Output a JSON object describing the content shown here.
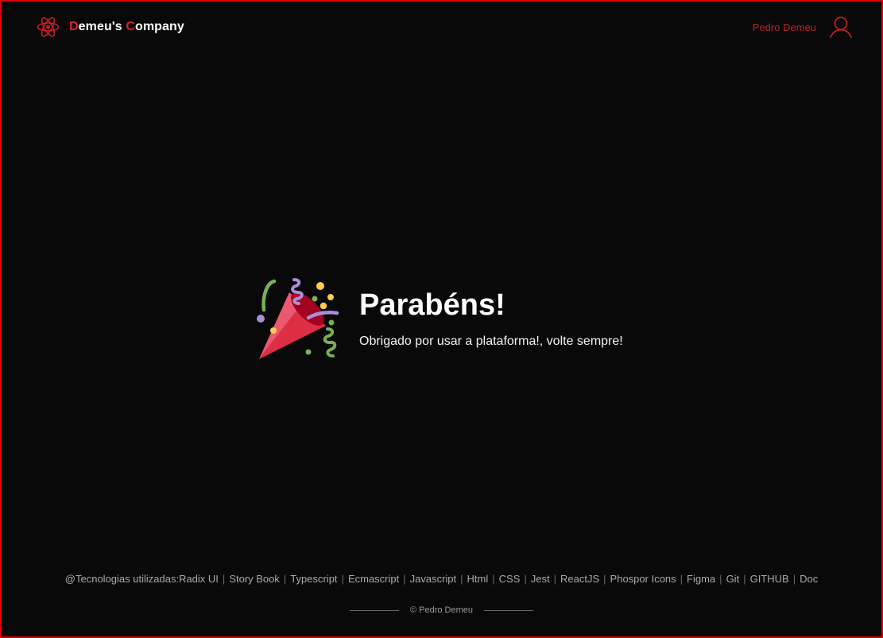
{
  "brand": {
    "first_initial": "D",
    "first_rest": "emeu's ",
    "second_initial": "C",
    "second_rest": "ompany",
    "icon": "atom-icon",
    "accent_color": "#d8222a"
  },
  "user": {
    "name": "Pedro Demeu",
    "icon": "user-icon"
  },
  "hero": {
    "icon": "party-popper-icon",
    "title": "Parabéns!",
    "subtitle": "Obrigado por usar a plataforma!, volte sempre!"
  },
  "footer": {
    "tech_prefix": "@Tecnologias utilizadas:",
    "tech_items": [
      "Radix UI",
      "Story Book",
      "Typescript",
      "Ecmascript",
      "Javascript",
      "Html",
      "CSS",
      "Jest",
      "ReactJS",
      "Phospor Icons",
      "Figma",
      "Git",
      "GITHUB",
      "Doc"
    ],
    "copyright": "© Pedro Demeu"
  },
  "colors": {
    "background": "#09090a",
    "border": "#e00000",
    "accent": "#d8222a"
  }
}
